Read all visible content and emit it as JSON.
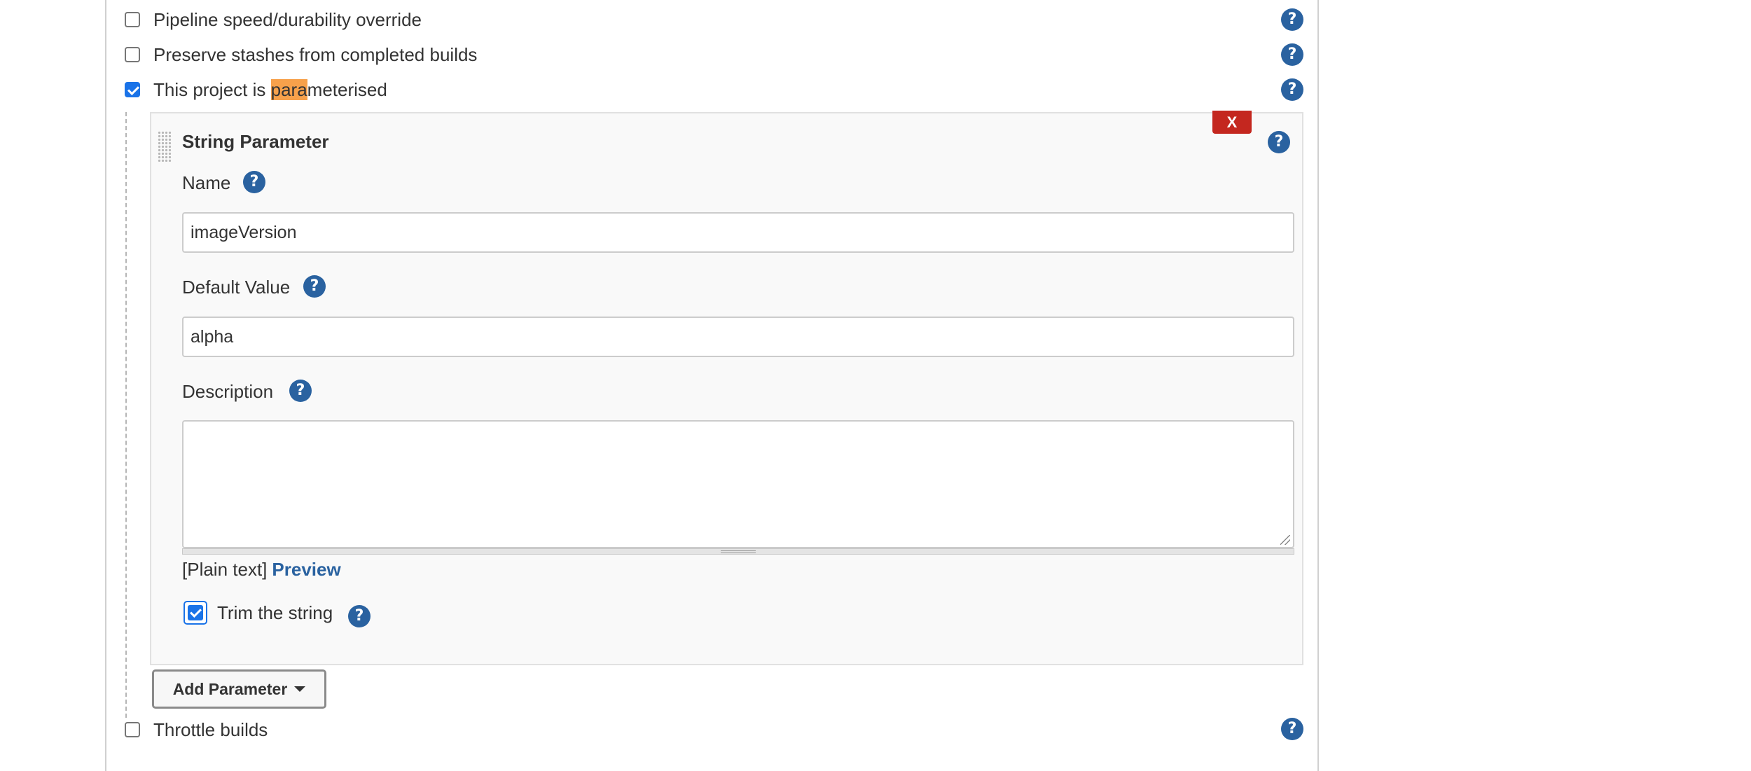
{
  "options": {
    "pipeline_speed": {
      "label": "Pipeline speed/durability override",
      "checked": false
    },
    "preserve_stashes": {
      "label": "Preserve stashes from completed builds",
      "checked": false
    },
    "parameterised": {
      "label_prefix": "This project is ",
      "label_highlight": "para",
      "label_suffix": "meterised",
      "checked": true
    },
    "throttle_builds": {
      "label": "Throttle builds",
      "checked": false
    }
  },
  "help_glyph": "?",
  "string_parameter": {
    "title": "String Parameter",
    "delete_label": "X",
    "name_label": "Name",
    "name_value": "imageVersion",
    "default_value_label": "Default Value",
    "default_value": "alpha",
    "description_label": "Description",
    "description_value": "",
    "format_text": "[Plain text]",
    "preview_link": "Preview",
    "trim_label": "Trim the string",
    "trim_checked": true
  },
  "add_parameter_label": "Add Parameter",
  "colors": {
    "help_icon": "#2a62a0",
    "delete_button": "#c4271f",
    "highlight": "#f7a14b",
    "link": "#2a62a0"
  }
}
